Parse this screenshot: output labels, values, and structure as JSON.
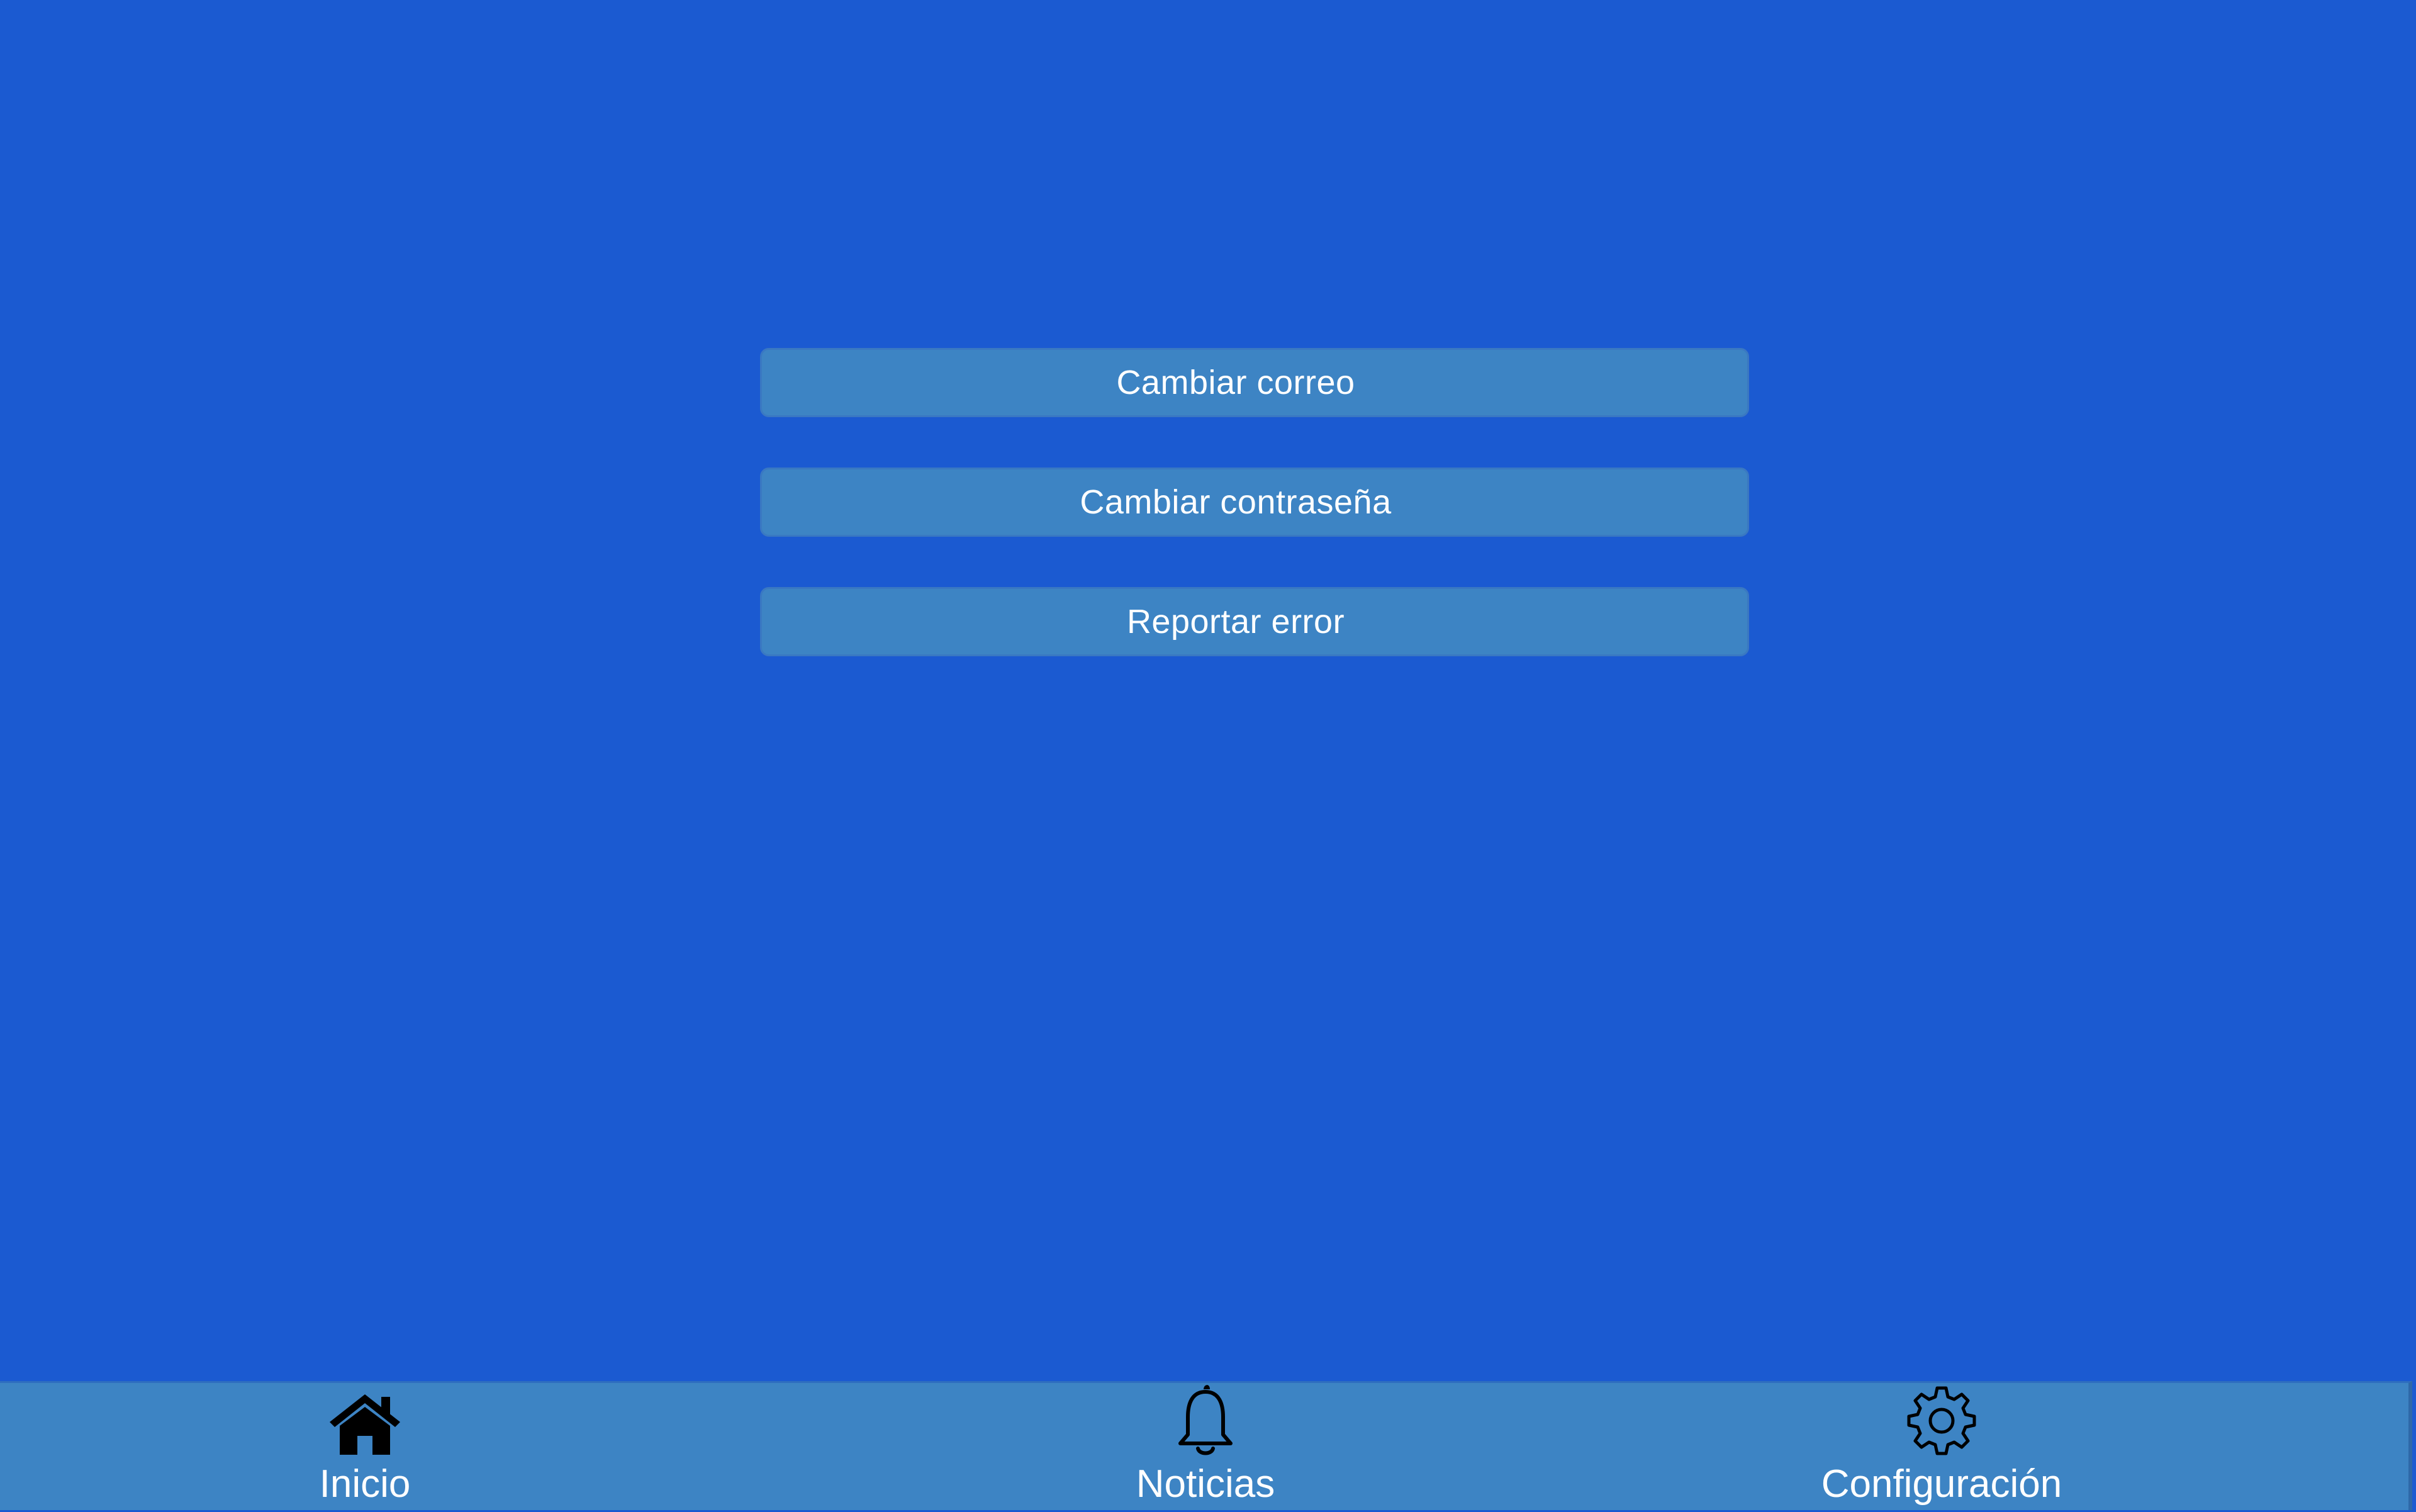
{
  "settings": {
    "buttons": [
      {
        "label": "Cambiar correo"
      },
      {
        "label": "Cambiar contraseña"
      },
      {
        "label": "Reportar error"
      }
    ]
  },
  "nav": {
    "items": [
      {
        "label": "Inicio",
        "icon": "home-icon"
      },
      {
        "label": "Noticias",
        "icon": "bell-icon"
      },
      {
        "label": "Configuración",
        "icon": "gear-icon"
      }
    ]
  },
  "colors": {
    "background": "#1b5ad1",
    "panel": "#3d84c4",
    "text": "#ffffff"
  }
}
